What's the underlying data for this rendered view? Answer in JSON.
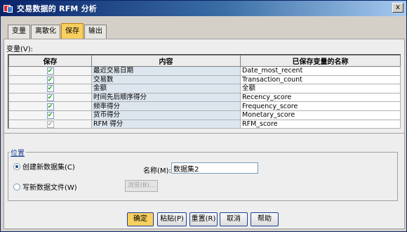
{
  "window": {
    "title": "交易数据的 RFM 分析",
    "close": "x"
  },
  "tabs": [
    {
      "label": "变量"
    },
    {
      "label": "离散化"
    },
    {
      "label": "保存"
    },
    {
      "label": "输出"
    }
  ],
  "variables_label": "变量(V):",
  "table": {
    "headers": [
      "保存",
      "内容",
      "已保存变量的名称"
    ],
    "rows": [
      {
        "checked": "✔",
        "content": "最近交易日期",
        "name": "Date_most_recent"
      },
      {
        "checked": "✔",
        "content": "交易数",
        "name": "Transaction_count"
      },
      {
        "checked": "✔",
        "content": "金额",
        "name": "全额"
      },
      {
        "checked": "✔",
        "content": "时间先后顺序得分",
        "name": "Recency_score"
      },
      {
        "checked": "✔",
        "content": "频率得分",
        "name": "Frequency_score"
      },
      {
        "checked": "✔",
        "content": "货币得分",
        "name": "Monetary_score"
      },
      {
        "checked": "✔",
        "content": "RFM 得分",
        "name": "RFM_score"
      }
    ]
  },
  "location": {
    "label": "位置",
    "option_new_dataset": "创建新数据集(C)",
    "option_write_file": "写新数据文件(W)",
    "name_label": "名称(M):",
    "name_value": "数据集2",
    "browse": "浏览(B)..."
  },
  "buttons": {
    "ok": "确定",
    "paste": "粘贴(P)",
    "reset": "重置(R)",
    "cancel": "取消",
    "help": "帮助"
  }
}
